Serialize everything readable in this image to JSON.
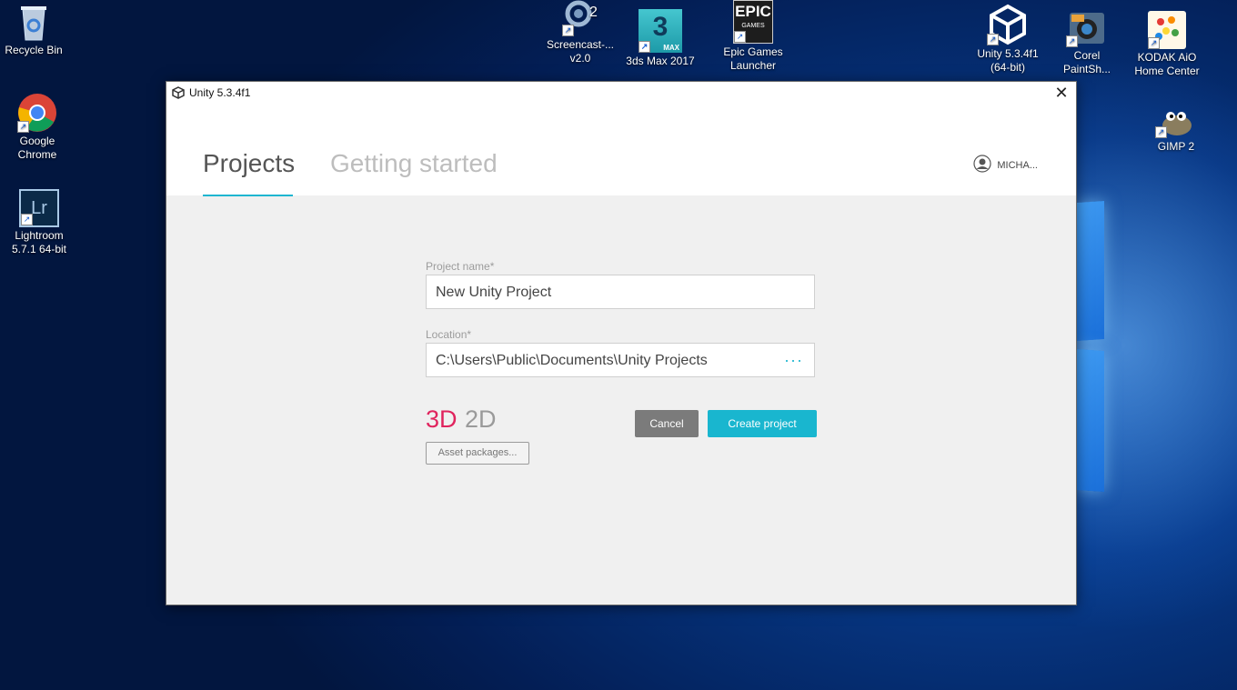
{
  "desktop": {
    "icons": [
      {
        "label": "Recycle Bin"
      },
      {
        "label": "Google\nChrome"
      },
      {
        "label": "Lightroom\n5.7.1 64-bit"
      },
      {
        "label": "Screencast-...\nv2.0"
      },
      {
        "label": "3ds Max 2017"
      },
      {
        "label": "Epic Games\nLauncher"
      },
      {
        "label": "Unity 5.3.4f1\n(64-bit)"
      },
      {
        "label": "Corel\nPaintSh..."
      },
      {
        "label": "KODAK AiO\nHome Center"
      },
      {
        "label": "GIMP 2"
      }
    ],
    "glyphs": {
      "lightroom": "Lr",
      "max_num": "3",
      "max_tag": "MAX",
      "epic_top": "EPIC",
      "epic_bottom": "GAMES",
      "screencast_num": "2"
    }
  },
  "window": {
    "title": "Unity 5.3.4f1",
    "close_glyph": "✕",
    "tabs": [
      {
        "label": "Projects",
        "active": true
      },
      {
        "label": "Getting started",
        "active": false
      }
    ],
    "account": "MICHA..."
  },
  "form": {
    "project_name_label": "Project name*",
    "project_name_value": "New Unity Project",
    "location_label": "Location*",
    "location_value": "C:\\Users\\Public\\Documents\\Unity Projects",
    "browse_glyph": "···",
    "mode_3d": "3D",
    "mode_2d": "2D",
    "selected_mode": "3D",
    "asset_packages": "Asset packages...",
    "cancel": "Cancel",
    "create": "Create project"
  },
  "colors": {
    "accent": "#1fb6d0",
    "mode_selected": "#e0245e",
    "mode_unselected": "#9a9a9a",
    "cancel_bg": "#7b7b7b",
    "create_bg": "#19b6cf"
  }
}
